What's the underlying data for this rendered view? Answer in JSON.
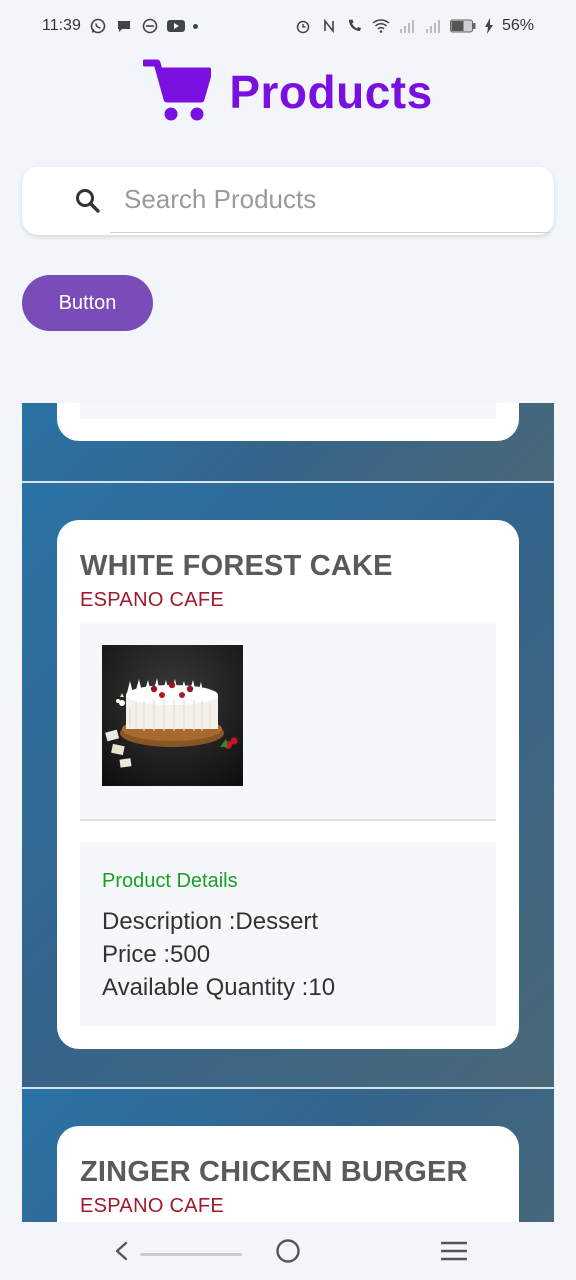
{
  "status_bar": {
    "time": "11:39",
    "battery": "56%",
    "left_icons": [
      "whatsapp-icon",
      "chat-icon",
      "messenger-icon",
      "youtube-icon",
      "dot-icon"
    ],
    "right_icons": [
      "alarm-icon",
      "nfc-icon",
      "wifi-call-icon",
      "wifi-icon",
      "signal-icon",
      "signal-icon",
      "battery-icon",
      "charging-icon"
    ]
  },
  "header": {
    "title": "Products",
    "icon": "shopping-cart-icon",
    "accent_color": "#7a10e0"
  },
  "search": {
    "placeholder": "Search Products",
    "value": ""
  },
  "action_button": {
    "label": "Button"
  },
  "products": [
    {
      "name": "WHITE FOREST CAKE",
      "vendor": "ESPANO CAFE",
      "image": "white-forest-cake-image",
      "details_heading": "Product Details",
      "description": "Description :Dessert",
      "price": "Price :500",
      "quantity": "Available Quantity :10"
    },
    {
      "name": "ZINGER CHICKEN BURGER",
      "vendor": "ESPANO CAFE"
    }
  ],
  "nav_bar": {
    "icons": [
      "back-icon",
      "home-icon",
      "recents-icon"
    ]
  }
}
